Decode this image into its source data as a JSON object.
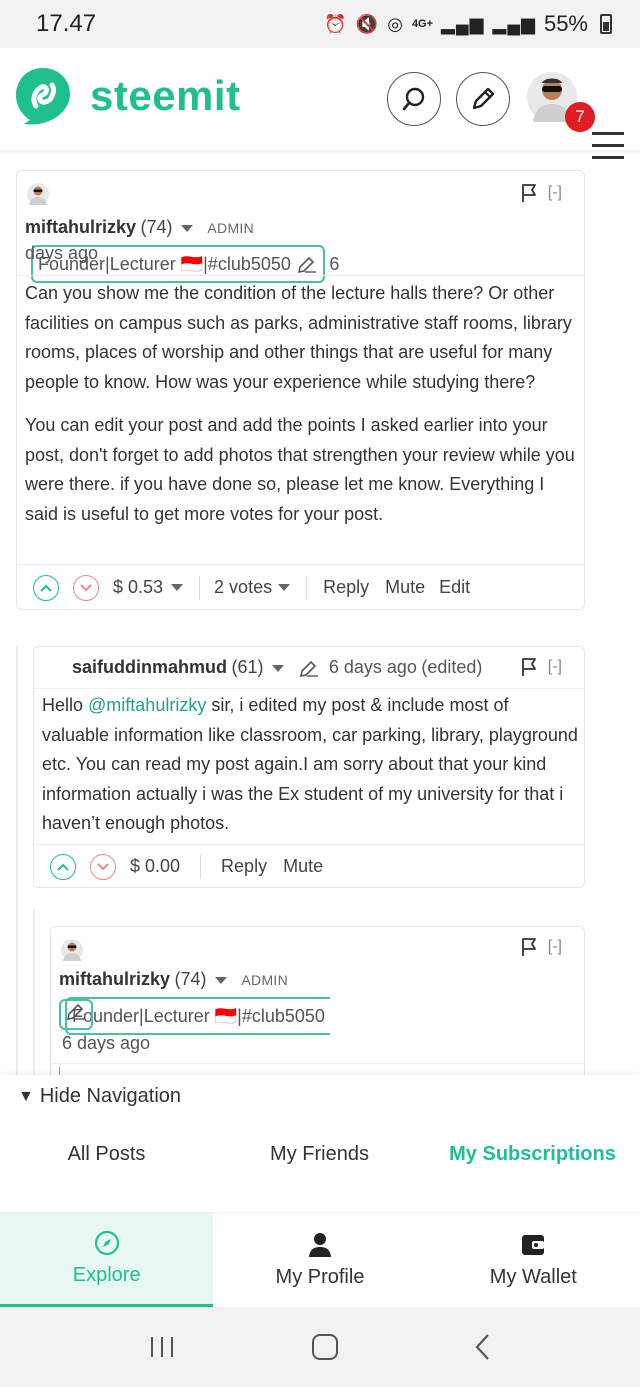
{
  "status_bar": {
    "time": "17.47",
    "network": "4G+",
    "battery": "55%"
  },
  "header": {
    "logo_text": "steemit",
    "notification_count": "7"
  },
  "comments": [
    {
      "author": "miftahulrizky",
      "reputation": "(74)",
      "role": "ADMIN",
      "badge": "Founder|Lecturer 🇮🇩|#club5050",
      "time_part1": "6",
      "time_part2": "days ago",
      "paragraphs": [
        "Can you show me the condition of the lecture halls there? Or other facilities on campus such as parks, administrative staff rooms, library rooms, places of worship and other things that are useful for many people to know. How was your experience while studying there?",
        "You can edit your post and add the points I asked earlier into your post, don't forget to add photos that strengthen your review while you were there. if you have done so, please let me know. Everything I said is useful to get more votes for your post."
      ],
      "payout": "$ 0.53",
      "votes": "2 votes",
      "reply": "Reply",
      "mute": "Mute",
      "edit": "Edit",
      "collapse": "[-]"
    },
    {
      "author": "saifuddinmahmud",
      "reputation": "(61)",
      "time": "6 days ago",
      "edited": "(edited)",
      "mention": "@miftahulrizky",
      "text_before": "Hello ",
      "text_after": " sir, i edited my post & include most of valuable information like classroom, car parking, library, playground etc. You can read my post again.I am sorry about that your kind information actually i was the Ex student of my university for that i haven’t enough photos.",
      "payout": "$ 0.00",
      "reply": "Reply",
      "mute": "Mute",
      "collapse": "[-]"
    },
    {
      "author": "miftahulrizky",
      "reputation": "(74)",
      "role": "ADMIN",
      "badge": "Founder|Lecturer 🇮🇩|#club5050",
      "time": "6 days ago",
      "collapse": "[-]"
    }
  ],
  "navigation": {
    "hide_label": "Hide Navigation",
    "subtabs": [
      "All Posts",
      "My Friends",
      "My Subscriptions"
    ],
    "tabs": [
      "Explore",
      "My Profile",
      "My Wallet"
    ]
  },
  "colors": {
    "accent": "#1fbf8f",
    "badge_border": "#45c1a3",
    "notif": "#e21c23"
  }
}
